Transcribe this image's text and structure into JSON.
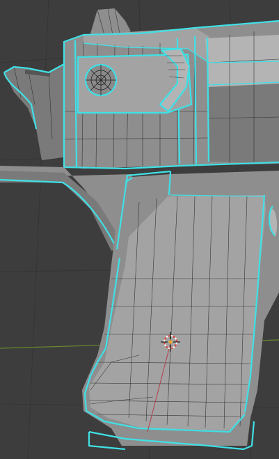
{
  "viewport": {
    "mode": "edit",
    "background_color": "#3d3d3d",
    "selection_color": "#3fe0e6",
    "mesh_color": "#9a9a9a",
    "x_axis_color": "#6b8a2f",
    "z_axis_color": "#b0404a",
    "cursor_icon": "3d-cursor-icon"
  }
}
